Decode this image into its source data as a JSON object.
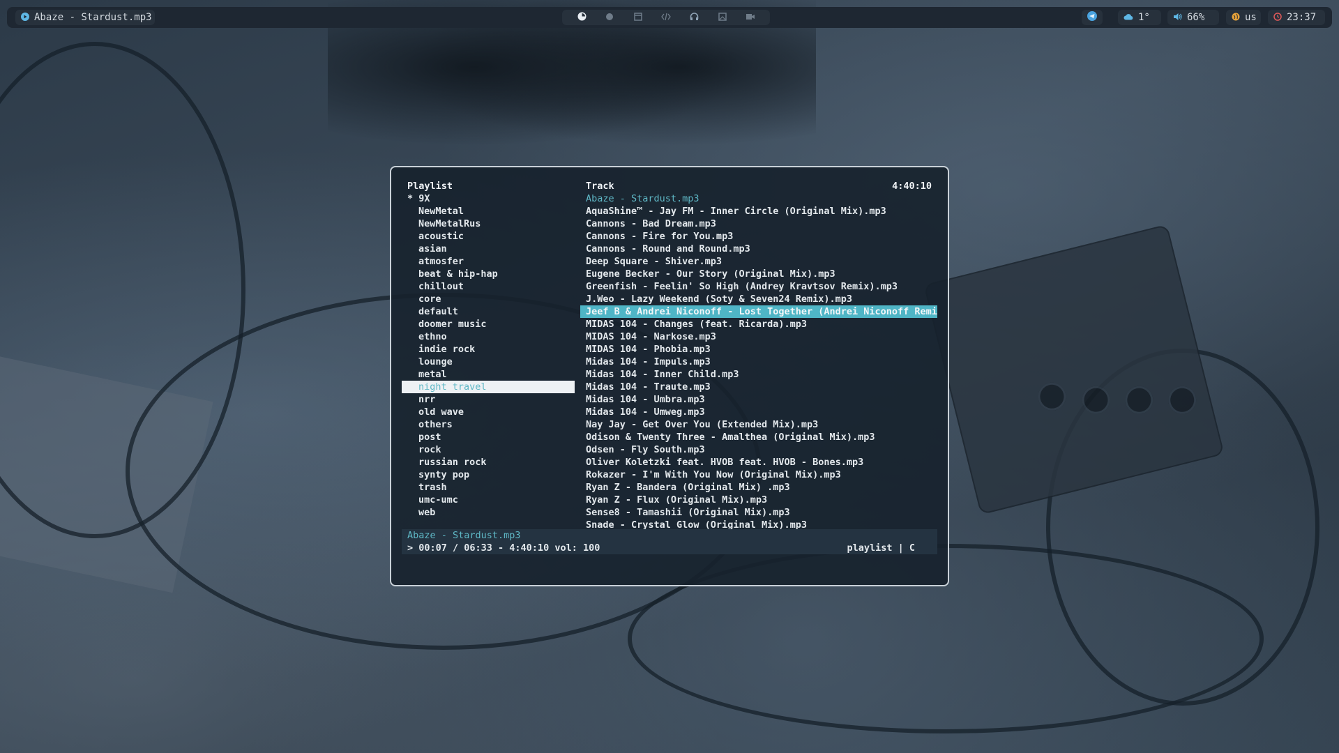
{
  "topbar": {
    "active_window_icon": "play-circle-icon",
    "active_window_title": "Abaze - Stardust.mp3",
    "workspaces": [
      {
        "icon": "firefox-icon",
        "active": true
      },
      {
        "icon": "circle-icon",
        "active": false
      },
      {
        "icon": "window-icon",
        "active": false
      },
      {
        "icon": "code-icon",
        "active": false
      },
      {
        "icon": "headphones-icon",
        "active": false
      },
      {
        "icon": "image-icon",
        "active": false
      },
      {
        "icon": "video-icon",
        "active": false
      }
    ],
    "telegram_icon": "telegram-icon",
    "weather": "1°",
    "volume": "66%",
    "layout": "us",
    "clock": "23:37",
    "accent_colors": {
      "weather": "#5fb8e6",
      "volume": "#5fb8e6",
      "layout": "#e8a33a",
      "clock": "#e05a5a",
      "telegram": "#4aa3df"
    }
  },
  "player": {
    "playlist_header": "Playlist",
    "track_header": "Track",
    "total_duration": "4:40:10",
    "playlists": [
      "* 9X",
      "NewMetal",
      "NewMetalRus",
      "acoustic",
      "asian",
      "atmosfer",
      "beat & hip-hap",
      "chillout",
      "core",
      "default",
      "doomer music",
      "ethno",
      "indie rock",
      "lounge",
      "metal",
      "night travel",
      "nrr",
      "old wave",
      "others",
      "post",
      "rock",
      "russian rock",
      "synty pop",
      "trash",
      "umc-umc",
      "web"
    ],
    "selected_playlist_index": 15,
    "tracks": [
      "Abaze - Stardust.mp3",
      "AquaShine™ - Jay FM - Inner Circle (Original Mix).mp3",
      "Cannons - Bad Dream.mp3",
      "Cannons - Fire for You.mp3",
      "Cannons - Round and Round.mp3",
      "Deep Square - Shiver.mp3",
      "Eugene Becker - Our Story (Original Mix).mp3",
      "Greenfish - Feelin' So High (Andrey Kravtsov Remix).mp3",
      "J.Weo - Lazy Weekend (Soty & Seven24 Remix).mp3",
      "Jeef B & Andrei Niconoff - Lost Together (Andrei Niconoff Remi…",
      "MIDAS 104 - Changes (feat. Ricarda).mp3",
      "MIDAS 104 - Narkose.mp3",
      "MIDAS 104 - Phobia.mp3",
      "Midas 104 - Impuls.mp3",
      "Midas 104 - Inner Child.mp3",
      "Midas 104 - Traute.mp3",
      "Midas 104 - Umbra.mp3",
      "Midas 104 - Umweg.mp3",
      "Nay Jay - Get Over You (Extended Mix).mp3",
      "Odison & Twenty Three - Amalthea (Original Mix).mp3",
      "Odsen - Fly South.mp3",
      "Oliver Koletzki feat. HVOB feat. HVOB - Bones.mp3",
      "Rokazer - I'm With You Now (Original Mix).mp3",
      "Ryan Z - Bandera (Original Mix) .mp3",
      "Ryan Z - Flux (Original Mix).mp3",
      "Sense8 - Tamashii (Original Mix).mp3",
      "Snade - Crystal Glow (Original Mix).mp3"
    ],
    "playing_track_index": 0,
    "selected_track_index": 9,
    "status": {
      "now_playing": "Abaze - Stardust.mp3",
      "progress_line": "> 00:07 / 06:33 - 4:40:10 vol: 100",
      "mode": "playlist | C"
    },
    "colors": {
      "accent": "#5fb8c6",
      "selection_bg": "#4fb5c6"
    }
  }
}
